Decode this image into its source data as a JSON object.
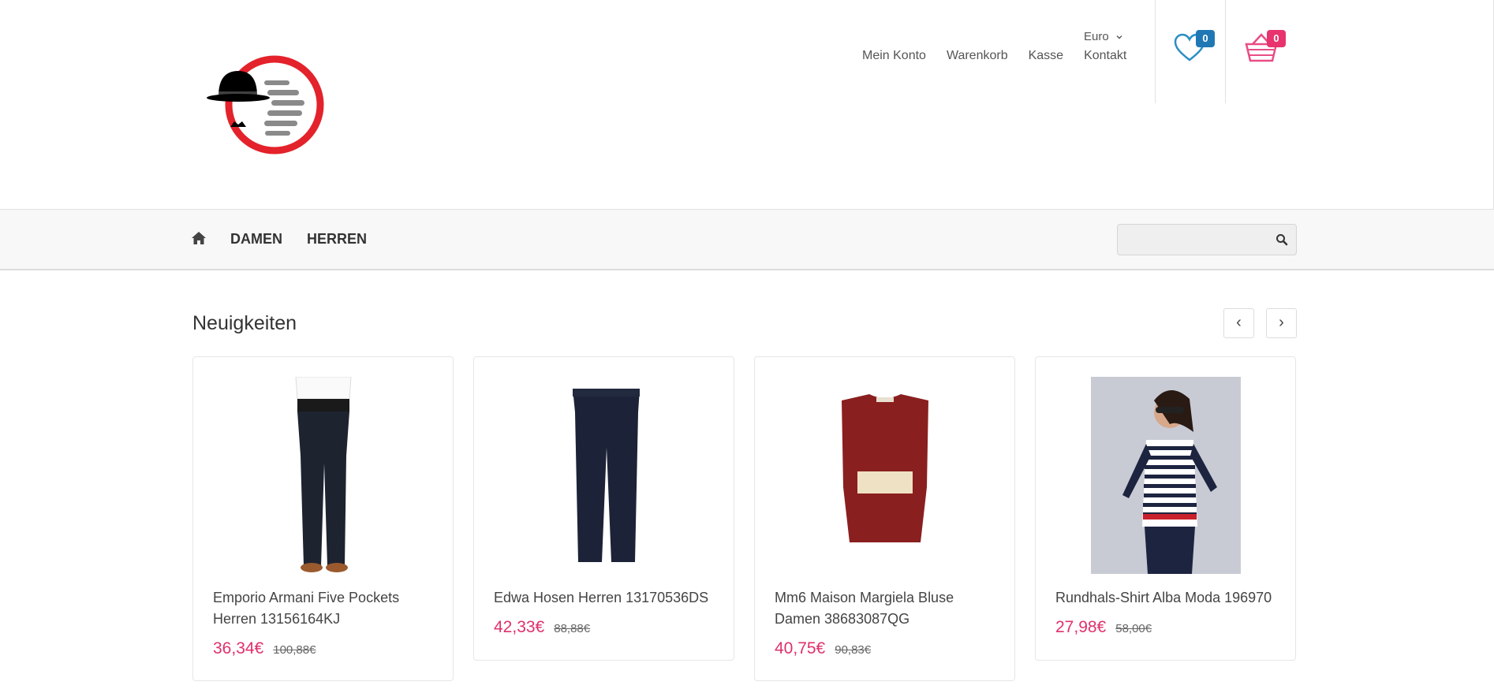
{
  "header": {
    "currency": "Euro",
    "links": [
      "Mein Konto",
      "Warenkorb",
      "Kasse",
      "Kontakt"
    ],
    "wishlist_count": "0",
    "cart_count": "0"
  },
  "nav": {
    "items": [
      "DAMEN",
      "HERREN"
    ],
    "search_placeholder": ""
  },
  "section": {
    "title": "Neuigkeiten",
    "prev": "‹",
    "next": "›"
  },
  "products": [
    {
      "name": "Emporio Armani Five Pockets Herren 13156164KJ",
      "price": "36,34€",
      "old_price": "100,88€"
    },
    {
      "name": "Edwa Hosen Herren 13170536DS",
      "price": "42,33€",
      "old_price": "88,88€"
    },
    {
      "name": "Mm6 Maison Margiela Bluse Damen 38683087QG",
      "price": "40,75€",
      "old_price": "90,83€"
    },
    {
      "name": "Rundhals-Shirt Alba Moda 196970",
      "price": "27,98€",
      "old_price": "58,00€"
    }
  ],
  "colors": {
    "accent": "#e0316b",
    "wishlist_icon": "#2a8fc4",
    "wishlist_badge": "#1f78b4",
    "cart_icon": "#e84d86",
    "cart_badge": "#e8336e",
    "logo_ring": "#e3222b"
  }
}
